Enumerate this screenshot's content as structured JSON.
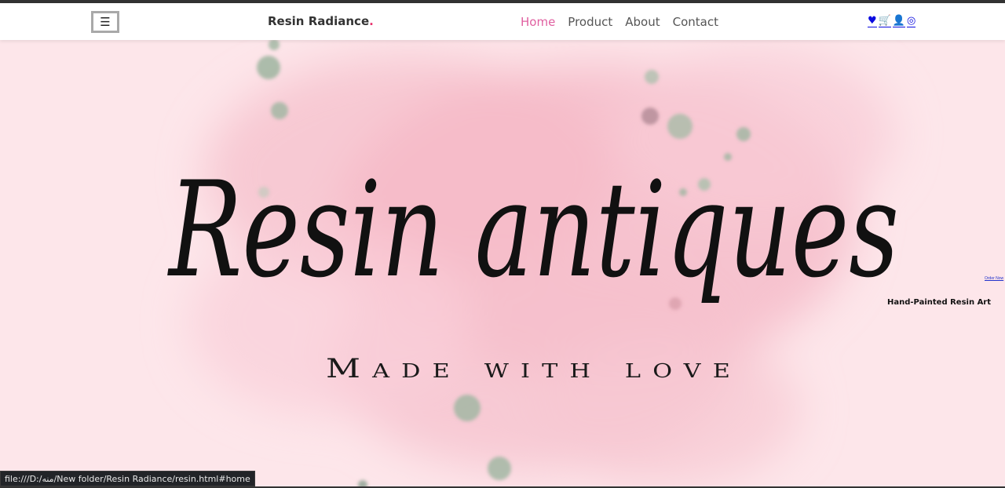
{
  "navbar": {
    "menu_icon": "☰",
    "brand_name": "Resin Radiance",
    "brand_dot": ".",
    "links": [
      {
        "label": "Home",
        "active": true
      },
      {
        "label": "Product",
        "active": false
      },
      {
        "label": "About",
        "active": false
      },
      {
        "label": "Contact",
        "active": false
      }
    ],
    "icons": [
      {
        "name": "heart-icon",
        "glyph": "♥"
      },
      {
        "name": "cart-icon",
        "glyph": "🛒"
      },
      {
        "name": "user-icon",
        "glyph": "👤"
      },
      {
        "name": "instagram-icon",
        "glyph": "◎"
      }
    ]
  },
  "hero": {
    "title": "Resin antiques",
    "subtitle": "Made with love",
    "order_link": "Order Now",
    "tagline": "Hand-Painted Resin Art"
  },
  "status_bar": {
    "url": "file:///D:/منه/New folder/Resin Radiance/resin.html#home"
  },
  "colors": {
    "accent": "#e05fa0",
    "brand_dot": "#e8336d",
    "icon_blue": "#0a0ae0",
    "hero_bg": "#fde6ea"
  }
}
